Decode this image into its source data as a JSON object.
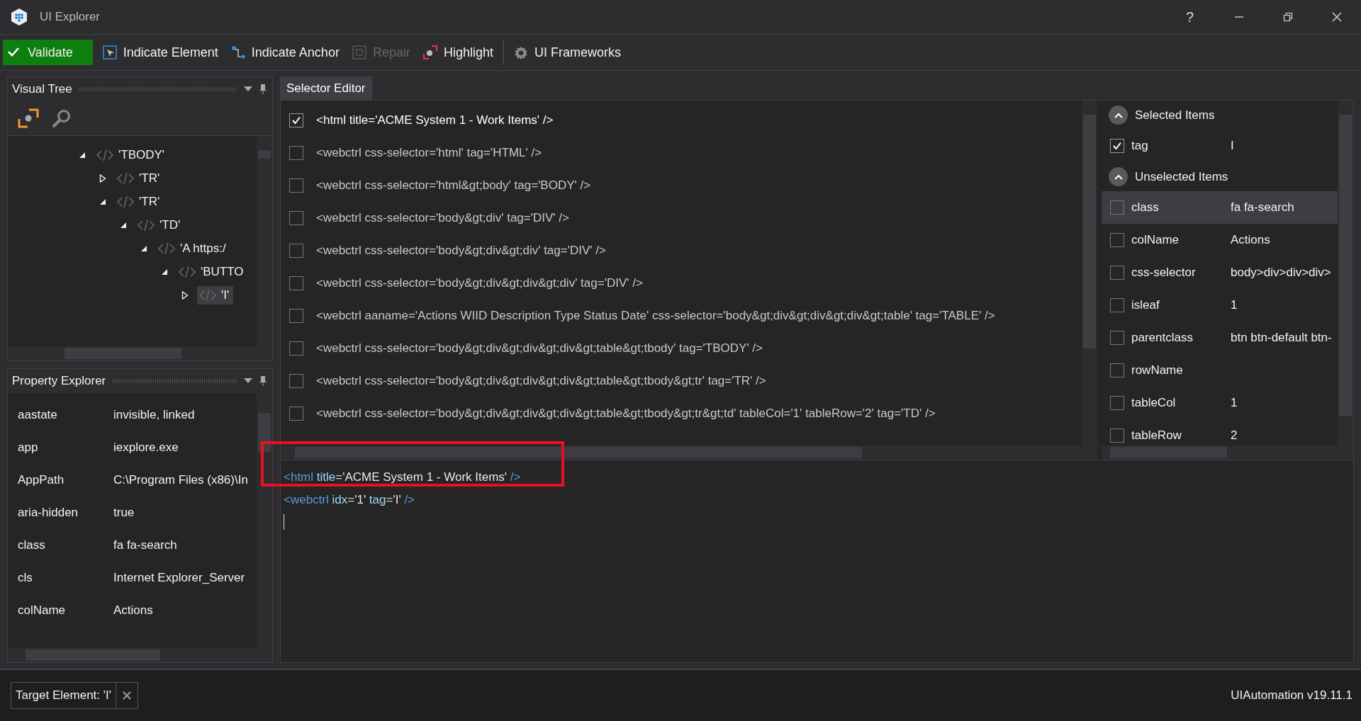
{
  "window": {
    "title": "UI Explorer",
    "help": "?"
  },
  "toolbar": [
    {
      "kind": "validate",
      "label": "Validate",
      "disabled": false
    },
    {
      "kind": "indicate-element",
      "label": "Indicate Element",
      "disabled": false
    },
    {
      "kind": "indicate-anchor",
      "label": "Indicate Anchor",
      "disabled": false
    },
    {
      "kind": "repair",
      "label": "Repair",
      "disabled": true
    },
    {
      "kind": "highlight",
      "label": "Highlight",
      "disabled": false
    },
    {
      "kind": "frameworks",
      "label": "UI Frameworks",
      "disabled": false
    }
  ],
  "visual_tree": {
    "title": "Visual Tree",
    "nodes": [
      {
        "label": "'TBODY'",
        "expanded": true,
        "selected": false,
        "children": [
          {
            "label": "'TR'",
            "expanded": false,
            "selected": false
          },
          {
            "label": "'TR'",
            "expanded": true,
            "selected": false,
            "children": [
              {
                "label": "'TD'",
                "expanded": true,
                "selected": false,
                "children": [
                  {
                    "label": "'A  https:/",
                    "expanded": true,
                    "selected": false,
                    "children": [
                      {
                        "label": "'BUTTO",
                        "expanded": true,
                        "selected": false,
                        "children": [
                          {
                            "label": "'I'",
                            "expanded": false,
                            "selected": true
                          }
                        ]
                      }
                    ]
                  }
                ]
              }
            ]
          }
        ]
      }
    ]
  },
  "property_explorer": {
    "title": "Property Explorer",
    "rows": [
      {
        "name": "aastate",
        "value": "invisible, linked"
      },
      {
        "name": "app",
        "value": "iexplore.exe"
      },
      {
        "name": "AppPath",
        "value": "C:\\Program Files (x86)\\In"
      },
      {
        "name": "aria-hidden",
        "value": "true"
      },
      {
        "name": "class",
        "value": "fa fa-search"
      },
      {
        "name": "cls",
        "value": "Internet Explorer_Server"
      },
      {
        "name": "colName",
        "value": "Actions"
      }
    ]
  },
  "selector_editor": {
    "tab": {
      "label": "Selector Editor",
      "selected": true
    },
    "lines": [
      {
        "text": "<html title='ACME System 1 - Work Items' />",
        "checked": true
      },
      {
        "text": "<webctrl css-selector='html' tag='HTML' />",
        "checked": false
      },
      {
        "text": "<webctrl css-selector='html&gt;body' tag='BODY' />",
        "checked": false
      },
      {
        "text": "<webctrl css-selector='body&gt;div' tag='DIV' />",
        "checked": false
      },
      {
        "text": "<webctrl css-selector='body&gt;div&gt;div' tag='DIV' />",
        "checked": false
      },
      {
        "text": "<webctrl css-selector='body&gt;div&gt;div&gt;div' tag='DIV' />",
        "checked": false
      },
      {
        "text": "<webctrl aaname='Actions WIID Description Type Status Date' css-selector='body&gt;div&gt;div&gt;div&gt;table' tag='TABLE' />",
        "checked": false
      },
      {
        "text": "<webctrl css-selector='body&gt;div&gt;div&gt;div&gt;table&gt;tbody' tag='TBODY' />",
        "checked": false
      },
      {
        "text": "<webctrl css-selector='body&gt;div&gt;div&gt;div&gt;table&gt;tbody&gt;tr' tag='TR' />",
        "checked": false
      },
      {
        "text": "<webctrl css-selector='body&gt;div&gt;div&gt;div&gt;table&gt;tbody&gt;tr&gt;td' tableCol='1' tableRow='2' tag='TD' />",
        "checked": false
      }
    ],
    "groups": [
      {
        "title": "Selected Items",
        "expanded": true,
        "rows": [
          {
            "name": "tag",
            "value": "I",
            "checked": true,
            "selected": false
          }
        ]
      },
      {
        "title": "Unselected Items",
        "expanded": true,
        "rows": [
          {
            "name": "class",
            "value": "fa fa-search",
            "checked": false,
            "selected": true
          },
          {
            "name": "colName",
            "value": "Actions",
            "checked": false,
            "selected": false
          },
          {
            "name": "css-selector",
            "value": "body>div>div>div>",
            "checked": false,
            "selected": false
          },
          {
            "name": "isleaf",
            "value": "1",
            "checked": false,
            "selected": false
          },
          {
            "name": "parentclass",
            "value": "btn btn-default btn-",
            "checked": false,
            "selected": false
          },
          {
            "name": "rowName",
            "checked": false,
            "selected": false
          },
          {
            "name": "tableCol",
            "value": "1",
            "checked": false,
            "selected": false
          },
          {
            "name": "tableRow",
            "value": "2",
            "checked": false,
            "selected": false
          }
        ]
      }
    ],
    "code_lines": [
      "<html title='ACME System 1 - Work Items' />",
      "<webctrl idx='1' tag='I' />"
    ]
  },
  "annotations": [
    {
      "kind": "frame"
    }
  ],
  "status_bar": {
    "target": "Target Element: 'I'",
    "version": "UIAutomation v19.11.1"
  }
}
